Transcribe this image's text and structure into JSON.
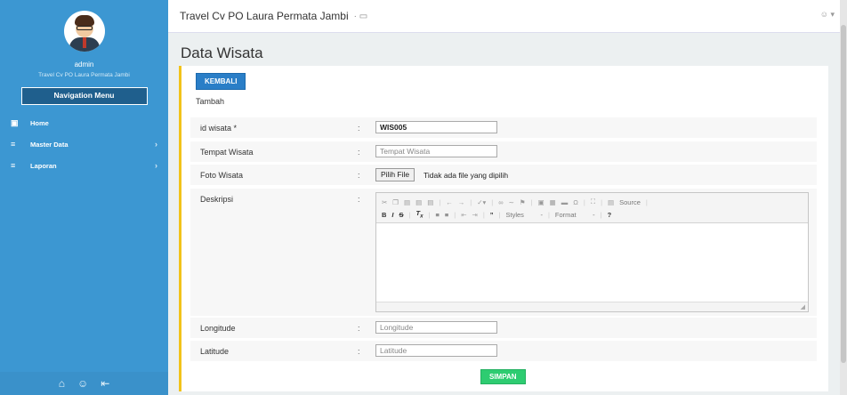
{
  "sidebar": {
    "username": "admin",
    "subtitle": "Travel Cv PO Laura Permata Jambi",
    "nav_menu_label": "Navigation Menu",
    "items": [
      {
        "label": "Home",
        "icon": "home-icon"
      },
      {
        "label": "Master Data",
        "icon": "list-icon"
      },
      {
        "label": "Laporan",
        "icon": "list-icon"
      }
    ],
    "footer_icons": [
      "home-icon",
      "user-icon",
      "logout-icon"
    ]
  },
  "topbar": {
    "title": "Travel Cv PO Laura Permata Jambi"
  },
  "page": {
    "title": "Data Wisata",
    "back_button": "KEMBALI",
    "section_label": "Tambah",
    "submit_button": "SIMPAN"
  },
  "form": {
    "fields": [
      {
        "label": "id wisata *",
        "value": "WIS005"
      },
      {
        "label": "Tempat Wisata",
        "placeholder": "Tempat Wisata"
      },
      {
        "label": "Foto Wisata",
        "file_button": "Pilih File",
        "file_text": "Tidak ada file yang dipilih"
      },
      {
        "label": "Deskripsi"
      },
      {
        "label": "Longitude",
        "placeholder": "Longitude"
      },
      {
        "label": "Latitude",
        "placeholder": "Latitude"
      }
    ],
    "colon": ":"
  },
  "editor": {
    "source_label": "Source",
    "styles_label": "Styles",
    "format_label": "Format"
  },
  "colors": {
    "sidebar": "#3c97d2",
    "panel_accent": "#f2c31a",
    "primary_button": "#2a7ec7",
    "success_button": "#2ecc71"
  }
}
